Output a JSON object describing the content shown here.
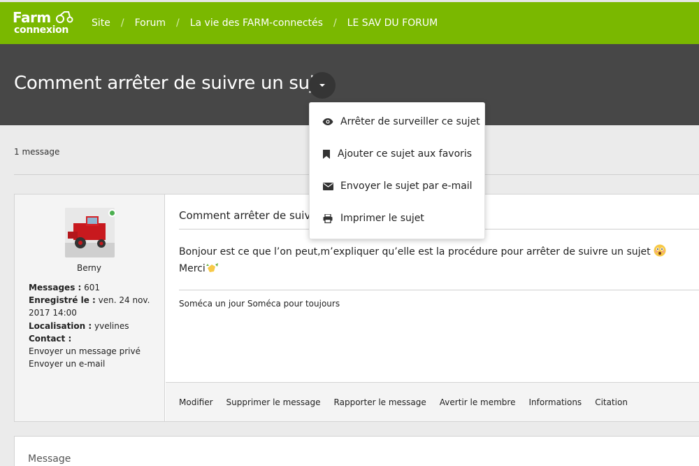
{
  "site": {
    "logo_line1": "Farm",
    "logo_line2": "connexion"
  },
  "breadcrumbs": [
    "Site",
    "Forum",
    "La vie des FARM-connectés",
    "LE SAV DU FORUM"
  ],
  "topic": {
    "title": "Comment arrêter de suivre un sujet",
    "message_count": "1 message"
  },
  "menu": {
    "items": [
      {
        "label": "Arrêter de surveiller ce sujet",
        "icon": "eye-icon"
      },
      {
        "label": "Ajouter ce sujet aux favoris",
        "icon": "bookmark-icon"
      },
      {
        "label": "Envoyer le sujet par e-mail",
        "icon": "envelope-icon"
      },
      {
        "label": "Imprimer le sujet",
        "icon": "printer-icon"
      }
    ]
  },
  "post": {
    "author": "Berny",
    "profile": {
      "messages_label": "Messages :",
      "messages_value": "601",
      "registered_label": "Enregistré le :",
      "registered_value": "ven. 24 nov. 2017 14:00",
      "location_label": "Localisation :",
      "location_value": "yvelines",
      "contact_label": "Contact :",
      "private_message": "Envoyer un message privé",
      "send_email": "Envoyer un e-mail"
    },
    "subject": "Comment arrêter de suivre",
    "body_line1": "Bonjour est ce que l’on peut,m’expliquer qu’elle est la procédure pour arrêter de suivre un sujet",
    "body_line2": "Merci",
    "signature": "Soméca un jour Soméca pour toujours",
    "actions": [
      "Modifier",
      "Supprimer le message",
      "Rapporter le message",
      "Avertir le membre",
      "Informations",
      "Citation"
    ]
  },
  "reply": {
    "label": "Message"
  },
  "colors": {
    "brand_green": "#7ab800",
    "title_band": "#474747",
    "online_status": "#4caf50"
  }
}
